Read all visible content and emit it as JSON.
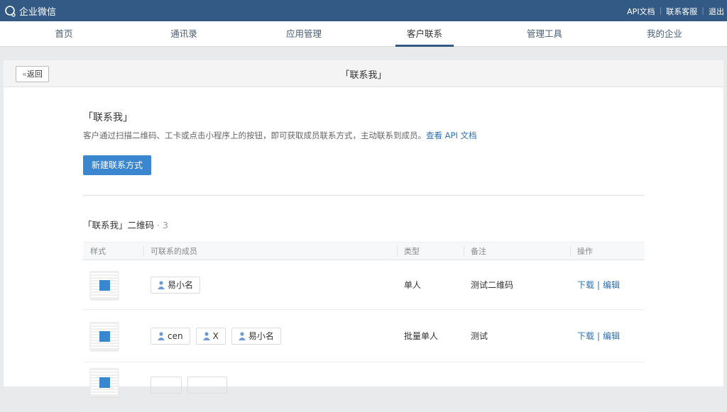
{
  "topbar": {
    "brand": "企业微信",
    "links": [
      "API文档",
      "联系客服",
      "退出"
    ]
  },
  "nav": {
    "items": [
      "首页",
      "通讯录",
      "应用管理",
      "客户联系",
      "管理工具",
      "我的企业"
    ],
    "active": 3
  },
  "panel": {
    "back_label": "返回",
    "title": "「联系我」"
  },
  "intro": {
    "heading": "「联系我」",
    "desc": "客户通过扫描二维码、工卡或点击小程序上的按钮，即可获取成员联系方式，主动联系到成员。",
    "api_link": "查看 API 文档",
    "new_button": "新建联系方式"
  },
  "list": {
    "title": "「联系我」二维码",
    "count": "· 3",
    "columns": [
      "样式",
      "可联系的成员",
      "类型",
      "备注",
      "操作"
    ],
    "rows": [
      {
        "members": [
          "易小名"
        ],
        "type": "单人",
        "note": "测试二维码",
        "download": "下载",
        "edit": "编辑"
      },
      {
        "members": [
          "cen",
          "X",
          "易小名"
        ],
        "type": "批量单人",
        "note": "测试",
        "download": "下载",
        "edit": "编辑"
      }
    ]
  }
}
